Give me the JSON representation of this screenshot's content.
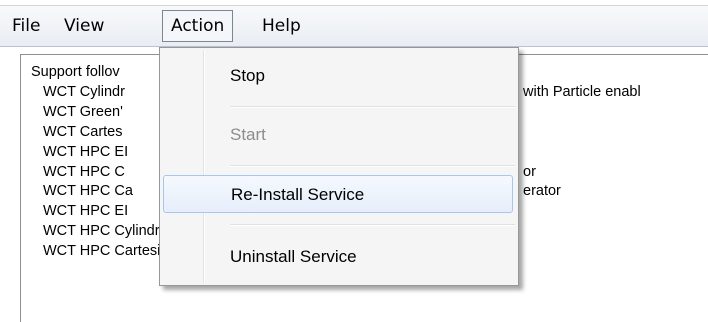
{
  "menubar": {
    "items": [
      {
        "label": "File"
      },
      {
        "label": "View"
      },
      {
        "label": "Action"
      },
      {
        "label": "Help"
      }
    ]
  },
  "content": {
    "lines": [
      "Support follov",
      "WCT Cylindr",
      "WCT Green'",
      "WCT Cartes",
      "WCT HPC EI",
      "WCT HPC C",
      "WCT HPC Ca",
      "WCT HPC EI",
      "WCT HPC Cylindrical EL (BHA) solver",
      "WCT HPC Cartesian EL + EL-IMG solver"
    ],
    "right_fragments": [
      "with Particle enabl",
      "or",
      "erator"
    ]
  },
  "action_menu": {
    "items": [
      {
        "label": "Stop",
        "enabled": true
      },
      {
        "label": "Start",
        "enabled": false
      },
      {
        "label": "Re-Install Service",
        "enabled": true,
        "highlighted": true
      },
      {
        "label": "Uninstall Service",
        "enabled": true
      }
    ]
  }
}
